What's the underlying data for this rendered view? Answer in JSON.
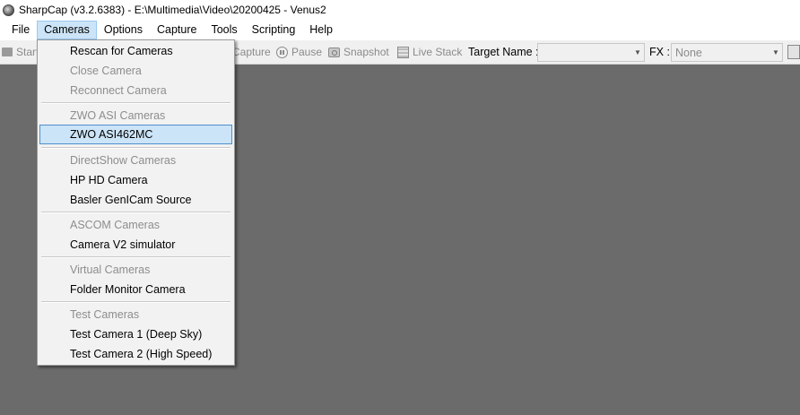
{
  "window": {
    "title": "SharpCap (v3.2.6383) - E:\\Multimedia\\Video\\20200425 - Venus2"
  },
  "menubar": {
    "items": [
      "File",
      "Cameras",
      "Options",
      "Capture",
      "Tools",
      "Scripting",
      "Help"
    ]
  },
  "toolbar": {
    "start_label": "Start",
    "capture_label": "Capture",
    "pause_label": "Pause",
    "snapshot_label": "Snapshot",
    "live_stack_label": "Live Stack",
    "target_name_label": "Target Name :",
    "target_name_value": "",
    "fx_label": "FX :",
    "fx_value": "None"
  },
  "cameras_menu": {
    "items": [
      {
        "label": "Rescan for Cameras",
        "enabled": true
      },
      {
        "label": "Close Camera",
        "enabled": false
      },
      {
        "label": "Reconnect Camera",
        "enabled": false
      },
      {
        "label": "ZWO ASI Cameras",
        "enabled": false
      },
      {
        "label": "ZWO ASI462MC",
        "enabled": true,
        "highlighted": true
      },
      {
        "label": "DirectShow Cameras",
        "enabled": false
      },
      {
        "label": "HP HD Camera",
        "enabled": true
      },
      {
        "label": "Basler GenICam Source",
        "enabled": true
      },
      {
        "label": "ASCOM Cameras",
        "enabled": false
      },
      {
        "label": "Camera V2 simulator",
        "enabled": true
      },
      {
        "label": "Virtual Cameras",
        "enabled": false
      },
      {
        "label": "Folder Monitor Camera",
        "enabled": true
      },
      {
        "label": "Test Cameras",
        "enabled": false
      },
      {
        "label": "Test Camera 1 (Deep Sky)",
        "enabled": true
      },
      {
        "label": "Test Camera 2 (High Speed)",
        "enabled": true
      }
    ]
  }
}
